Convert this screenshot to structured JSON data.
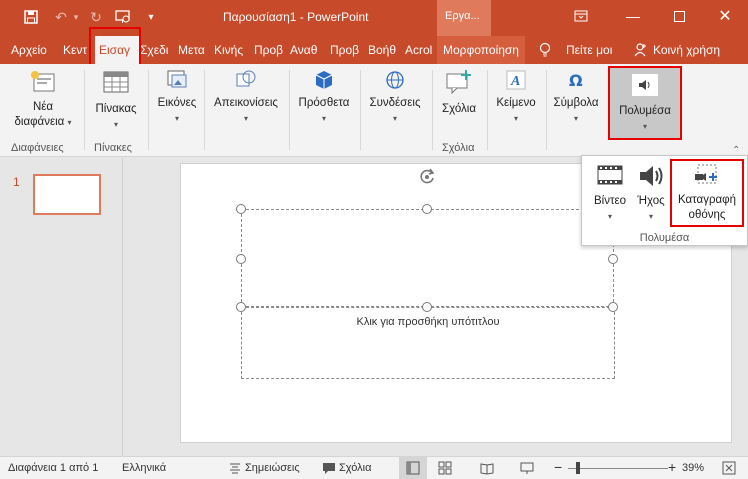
{
  "titlebar": {
    "title": "Παρουσίαση1  -  PowerPoint",
    "context_header": "Εργα...",
    "accent": "#c74a2b",
    "icons": [
      "save-icon",
      "undo-icon",
      "redo-icon",
      "start-slideshow-icon",
      "customize-qat-icon",
      "ribbon-display-icon",
      "minimize-icon",
      "maximize-icon",
      "close-icon"
    ]
  },
  "tabs": [
    "Αρχείο",
    "Κεντ",
    "Εισαγ",
    "Σχεδι",
    "Μετα",
    "Κινής",
    "Προβ",
    "Αναθ",
    "Προβ",
    "Βοήθ",
    "Acrol",
    "Μορφοποίηση",
    "Πείτε μοι",
    "Κοινή χρήση"
  ],
  "ribbon": {
    "new_slide": [
      "Νέα",
      "διαφάνεια"
    ],
    "group_slides": "Διαφάνειες",
    "tables": "Πίνακας",
    "group_tables": "Πίνακες",
    "images": "Εικόνες",
    "illustrations": "Απεικονίσεις",
    "addins": "Πρόσθετα",
    "links": "Συνδέσεις",
    "comment": "Σχόλια",
    "group_comments": "Σχόλια",
    "text": "Κείμενο",
    "symbols": "Σύμβολα",
    "media": "Πολυμέσα"
  },
  "dropdown": {
    "video": "Βίντεο",
    "audio": "Ήχος",
    "screen_recording": [
      "Καταγραφή",
      "οθόνης"
    ],
    "caption": "Πολυμέσα"
  },
  "slides": {
    "number": "1"
  },
  "canvas": {
    "subtitle_placeholder": "Κλικ για προσθήκη υπότιτλου"
  },
  "status": {
    "slide_info": "Διαφάνεια 1 από 1",
    "language": "Ελληνικά",
    "notes": "Σημειώσεις",
    "comments": "Σχόλια",
    "zoom": "39%",
    "zoom_fraction": 0.39
  }
}
